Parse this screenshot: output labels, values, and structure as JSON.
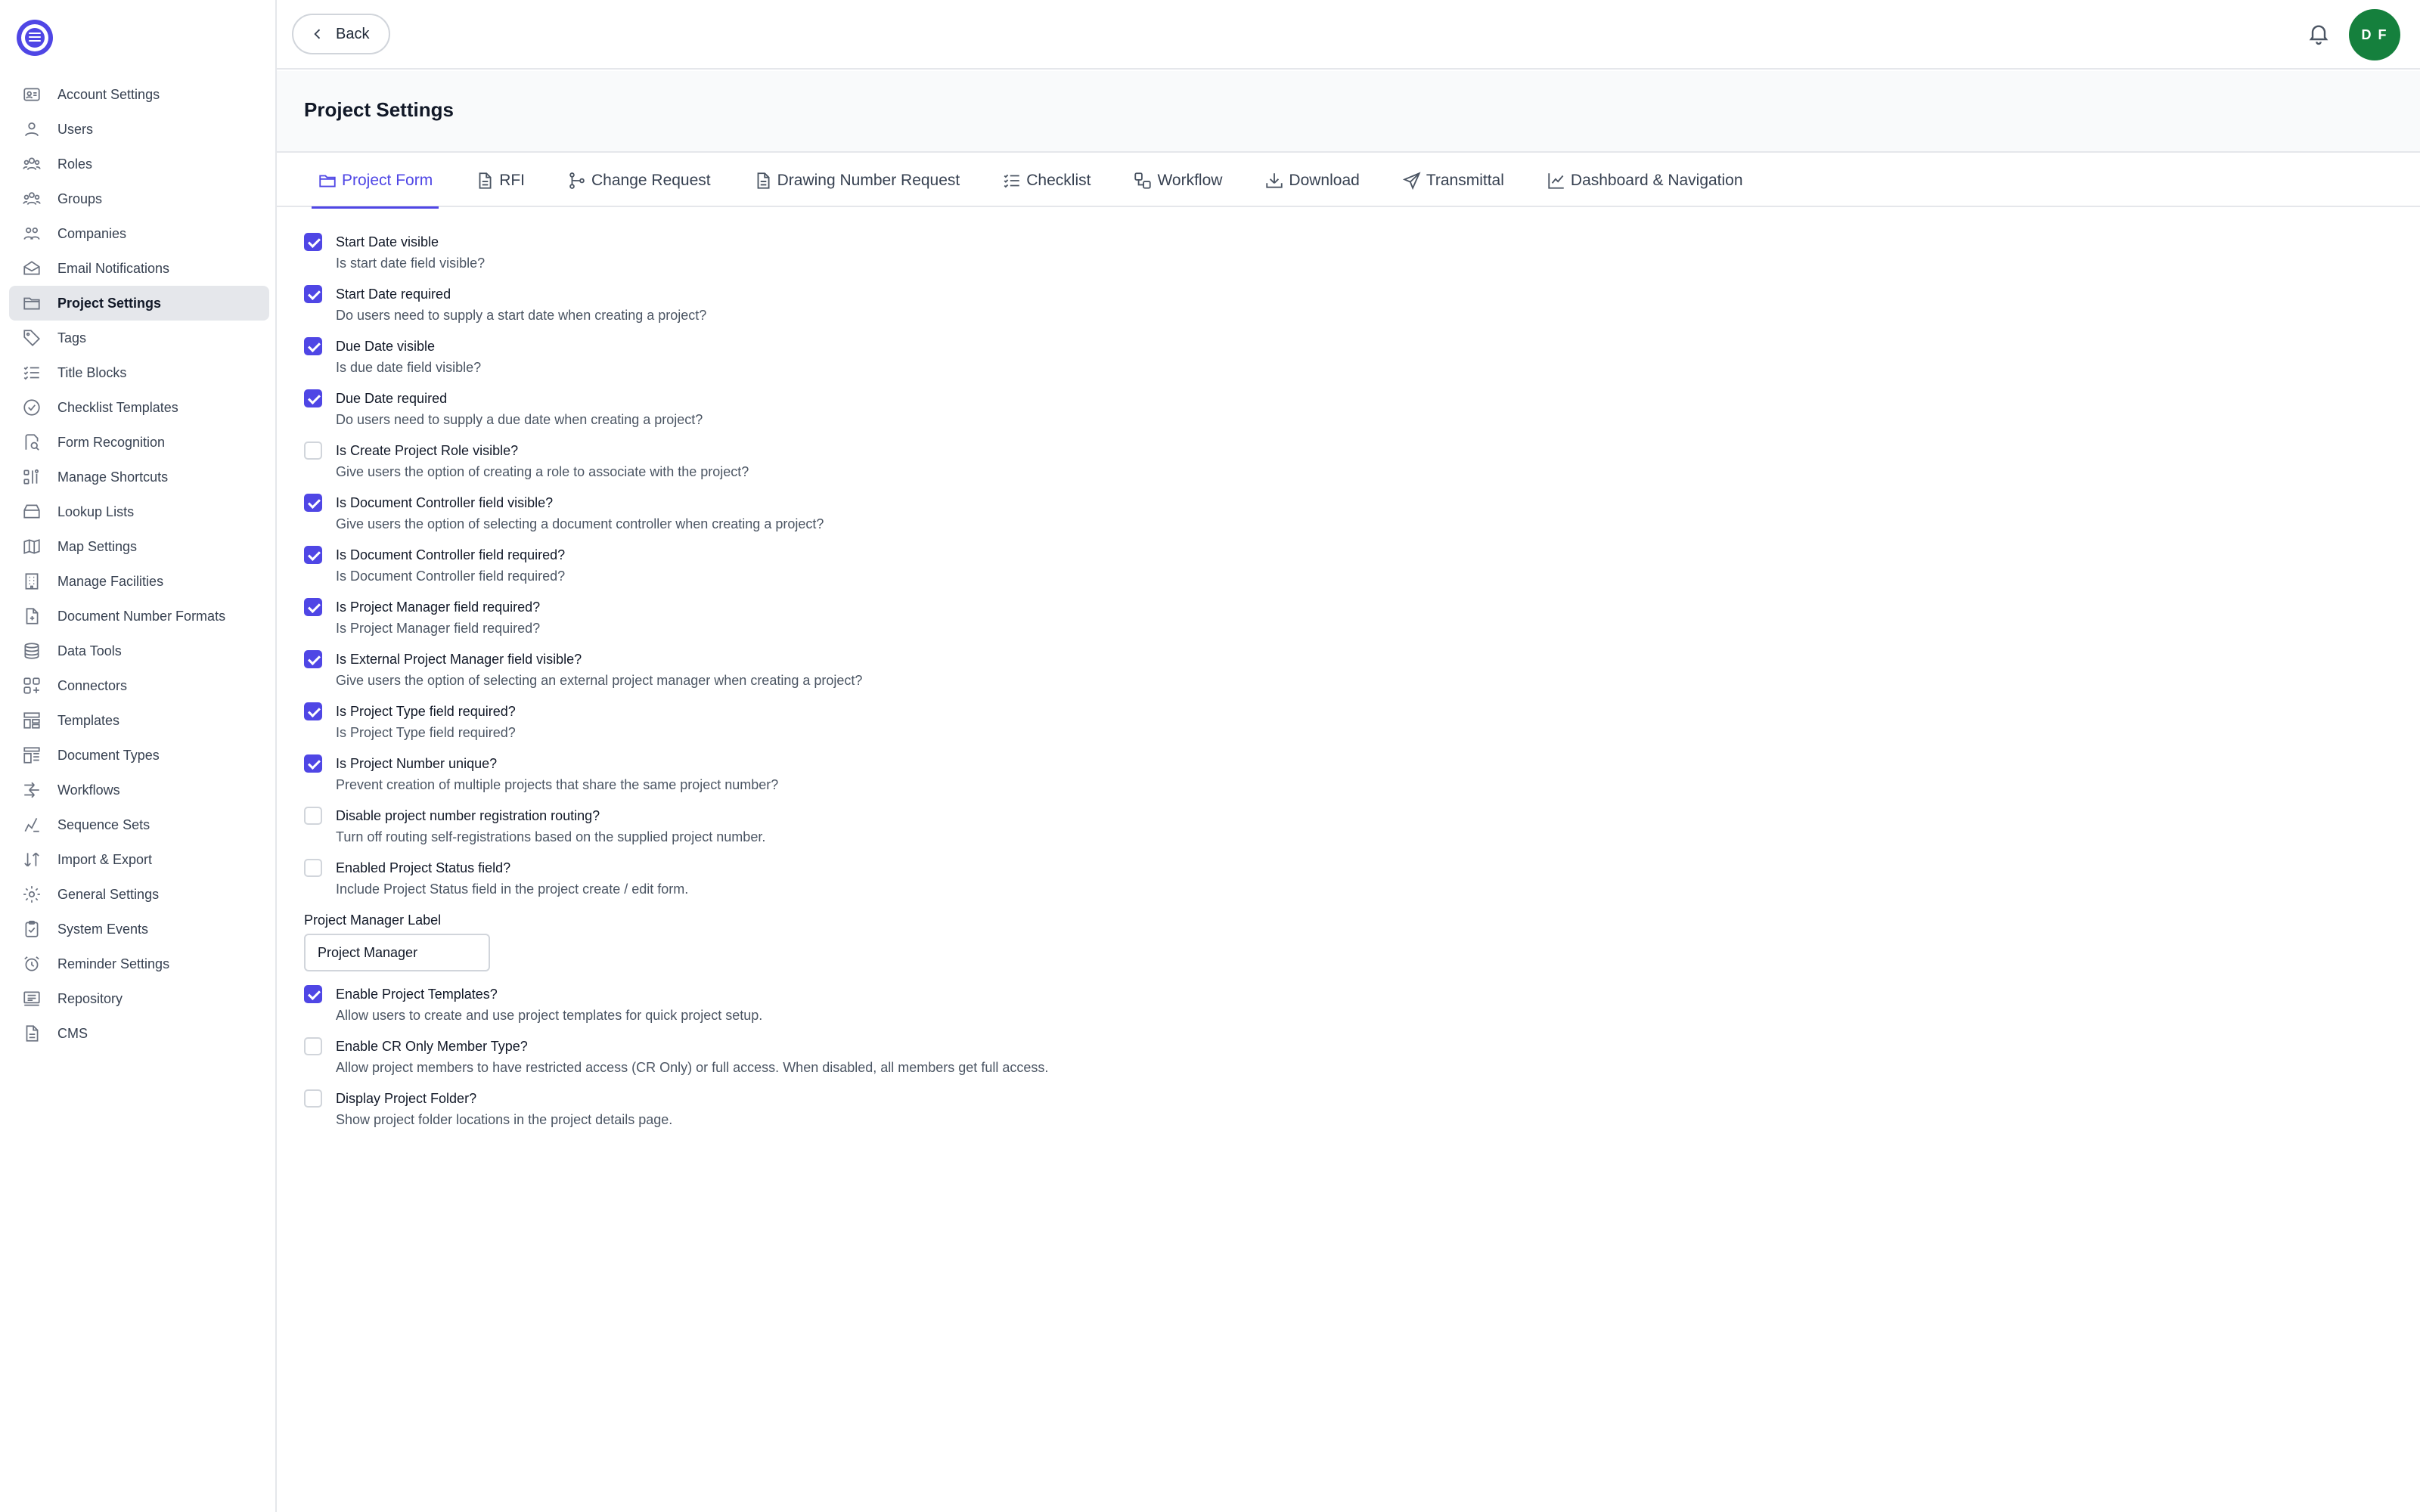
{
  "sidebar": {
    "items": [
      {
        "label": "Account Settings",
        "icon": "account-settings-icon"
      },
      {
        "label": "Users",
        "icon": "users-icon"
      },
      {
        "label": "Roles",
        "icon": "roles-icon"
      },
      {
        "label": "Groups",
        "icon": "groups-icon"
      },
      {
        "label": "Companies",
        "icon": "companies-icon"
      },
      {
        "label": "Email Notifications",
        "icon": "email-icon"
      },
      {
        "label": "Project Settings",
        "icon": "folder-icon",
        "active": true
      },
      {
        "label": "Tags",
        "icon": "tag-icon"
      },
      {
        "label": "Title Blocks",
        "icon": "list-check-icon"
      },
      {
        "label": "Checklist Templates",
        "icon": "check-circle-icon"
      },
      {
        "label": "Form Recognition",
        "icon": "form-search-icon"
      },
      {
        "label": "Manage Shortcuts",
        "icon": "shortcuts-icon"
      },
      {
        "label": "Lookup Lists",
        "icon": "lookup-icon"
      },
      {
        "label": "Map Settings",
        "icon": "map-icon"
      },
      {
        "label": "Manage Facilities",
        "icon": "building-icon"
      },
      {
        "label": "Document Number Formats",
        "icon": "document-number-icon"
      },
      {
        "label": "Data Tools",
        "icon": "database-icon"
      },
      {
        "label": "Connectors",
        "icon": "connectors-icon"
      },
      {
        "label": "Templates",
        "icon": "templates-icon"
      },
      {
        "label": "Document Types",
        "icon": "document-types-icon"
      },
      {
        "label": "Workflows",
        "icon": "workflows-icon"
      },
      {
        "label": "Sequence Sets",
        "icon": "sequence-icon"
      },
      {
        "label": "Import & Export",
        "icon": "import-export-icon"
      },
      {
        "label": "General Settings",
        "icon": "gear-icon"
      },
      {
        "label": "System Events",
        "icon": "clipboard-check-icon"
      },
      {
        "label": "Reminder Settings",
        "icon": "alarm-icon"
      },
      {
        "label": "Repository",
        "icon": "repository-icon"
      },
      {
        "label": "CMS",
        "icon": "cms-icon"
      }
    ]
  },
  "topbar": {
    "back_label": "Back",
    "avatar_initials": "D F"
  },
  "header": {
    "title": "Project Settings"
  },
  "tabs": [
    {
      "label": "Project Form",
      "icon": "folder-icon",
      "active": true
    },
    {
      "label": "RFI",
      "icon": "document-icon"
    },
    {
      "label": "Change Request",
      "icon": "branch-icon"
    },
    {
      "label": "Drawing Number Request",
      "icon": "document-icon"
    },
    {
      "label": "Checklist",
      "icon": "list-check-icon"
    },
    {
      "label": "Workflow",
      "icon": "workflow-icon"
    },
    {
      "label": "Download",
      "icon": "download-icon"
    },
    {
      "label": "Transmittal",
      "icon": "send-icon"
    },
    {
      "label": "Dashboard & Navigation",
      "icon": "chart-line-icon"
    }
  ],
  "form": {
    "options_a": [
      {
        "label": "Start Date visible",
        "desc": "Is start date field visible?",
        "checked": true
      },
      {
        "label": "Start Date required",
        "desc": "Do users need to supply a start date when creating a project?",
        "checked": true
      },
      {
        "label": "Due Date visible",
        "desc": "Is due date field visible?",
        "checked": true
      },
      {
        "label": "Due Date required",
        "desc": "Do users need to supply a due date when creating a project?",
        "checked": true
      },
      {
        "label": "Is Create Project Role visible?",
        "desc": "Give users the option of creating a role to associate with the project?",
        "checked": false
      },
      {
        "label": "Is Document Controller field visible?",
        "desc": "Give users the option of selecting a document controller when creating a project?",
        "checked": true
      },
      {
        "label": "Is Document Controller field required?",
        "desc": "Is Document Controller field required?",
        "checked": true
      },
      {
        "label": "Is Project Manager field required?",
        "desc": "Is Project Manager field required?",
        "checked": true
      },
      {
        "label": "Is External Project Manager field visible?",
        "desc": "Give users the option of selecting an external project manager when creating a project?",
        "checked": true
      },
      {
        "label": "Is Project Type field required?",
        "desc": "Is Project Type field required?",
        "checked": true
      },
      {
        "label": "Is Project Number unique?",
        "desc": "Prevent creation of multiple projects that share the same project number?",
        "checked": true
      },
      {
        "label": "Disable project number registration routing?",
        "desc": "Turn off routing self-registrations based on the supplied project number.",
        "checked": false
      },
      {
        "label": "Enabled Project Status field?",
        "desc": "Include Project Status field in the project create / edit form.",
        "checked": false
      }
    ],
    "pm_label": {
      "label": "Project Manager Label",
      "value": "Project Manager"
    },
    "options_b": [
      {
        "label": "Enable Project Templates?",
        "desc": "Allow users to create and use project templates for quick project setup.",
        "checked": true
      },
      {
        "label": "Enable CR Only Member Type?",
        "desc": "Allow project members to have restricted access (CR Only) or full access. When disabled, all members get full access.",
        "checked": false
      },
      {
        "label": "Display Project Folder?",
        "desc": "Show project folder locations in the project details page.",
        "checked": false
      }
    ]
  },
  "colors": {
    "accent": "#4f46e5",
    "avatar": "#15803d",
    "active_nav_bg": "#e5e7eb"
  }
}
